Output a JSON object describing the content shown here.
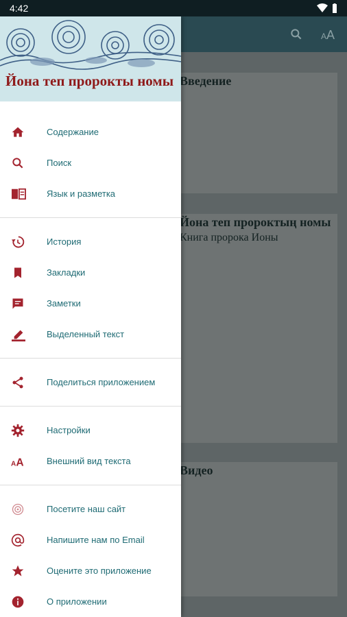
{
  "status": {
    "time": "4:42"
  },
  "drawer": {
    "header_title": "Йона теп пророкты номы",
    "sections": [
      [
        {
          "label": "Содержание",
          "icon": "home-icon"
        },
        {
          "label": "Поиск",
          "icon": "search-icon"
        },
        {
          "label": "Язык и разметка",
          "icon": "book-language-icon"
        }
      ],
      [
        {
          "label": "История",
          "icon": "history-icon"
        },
        {
          "label": "Закладки",
          "icon": "bookmark-icon"
        },
        {
          "label": "Заметки",
          "icon": "note-icon"
        },
        {
          "label": "Выделенный текст",
          "icon": "highlight-pen-icon"
        }
      ],
      [
        {
          "label": "Поделиться приложением",
          "icon": "share-icon"
        }
      ],
      [
        {
          "label": "Настройки",
          "icon": "gear-icon"
        },
        {
          "label": "Внешний вид текста",
          "icon": "text-size-icon"
        }
      ],
      [
        {
          "label": "Посетите наш сайт",
          "icon": "web-icon"
        },
        {
          "label": "Напишите нам по Email",
          "icon": "at-icon"
        },
        {
          "label": "Оцените это приложение",
          "icon": "star-icon"
        },
        {
          "label": "О приложении",
          "icon": "info-icon"
        }
      ]
    ]
  },
  "content": {
    "cards": [
      {
        "title": "Введение",
        "subtitle": ""
      },
      {
        "title": "Йона теп пророктың номы",
        "subtitle": "Книга пророка Ионы"
      },
      {
        "title": "Видео",
        "subtitle": ""
      }
    ]
  },
  "colors": {
    "accent": "#a3232e",
    "label": "#1f6b74",
    "appbar": "#2a4a52",
    "scrim": "#5e6566"
  }
}
